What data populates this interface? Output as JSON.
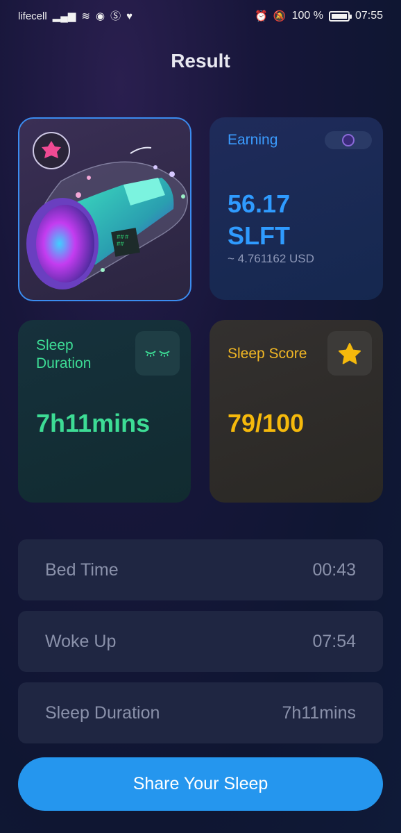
{
  "status_bar": {
    "carrier": "lifecell",
    "battery": "100 %",
    "time": "07:55"
  },
  "page_title": "Result",
  "earning": {
    "label": "Earning",
    "value_line1": "56.17",
    "value_line2": "SLFT",
    "usd": "~ 4.761162 USD"
  },
  "sleep_duration_card": {
    "label_line1": "Sleep",
    "label_line2": "Duration",
    "value": "7h11mins"
  },
  "sleep_score_card": {
    "label": "Sleep Score",
    "value": "79/100"
  },
  "details": [
    {
      "label": "Bed Time",
      "value": "00:43"
    },
    {
      "label": "Woke Up",
      "value": "07:54"
    },
    {
      "label": "Sleep Duration",
      "value": "7h11mins"
    }
  ],
  "share_button": "Share Your Sleep",
  "colors": {
    "accent_blue": "#2596ee",
    "earning_blue": "#2f9bff",
    "duration_green": "#3ddc95",
    "score_yellow": "#f5b90c"
  },
  "icons": {
    "nft": "sleep-pod-nft-image",
    "earning": "coin-icon",
    "duration": "closed-eyes-icon",
    "score": "star-icon"
  }
}
